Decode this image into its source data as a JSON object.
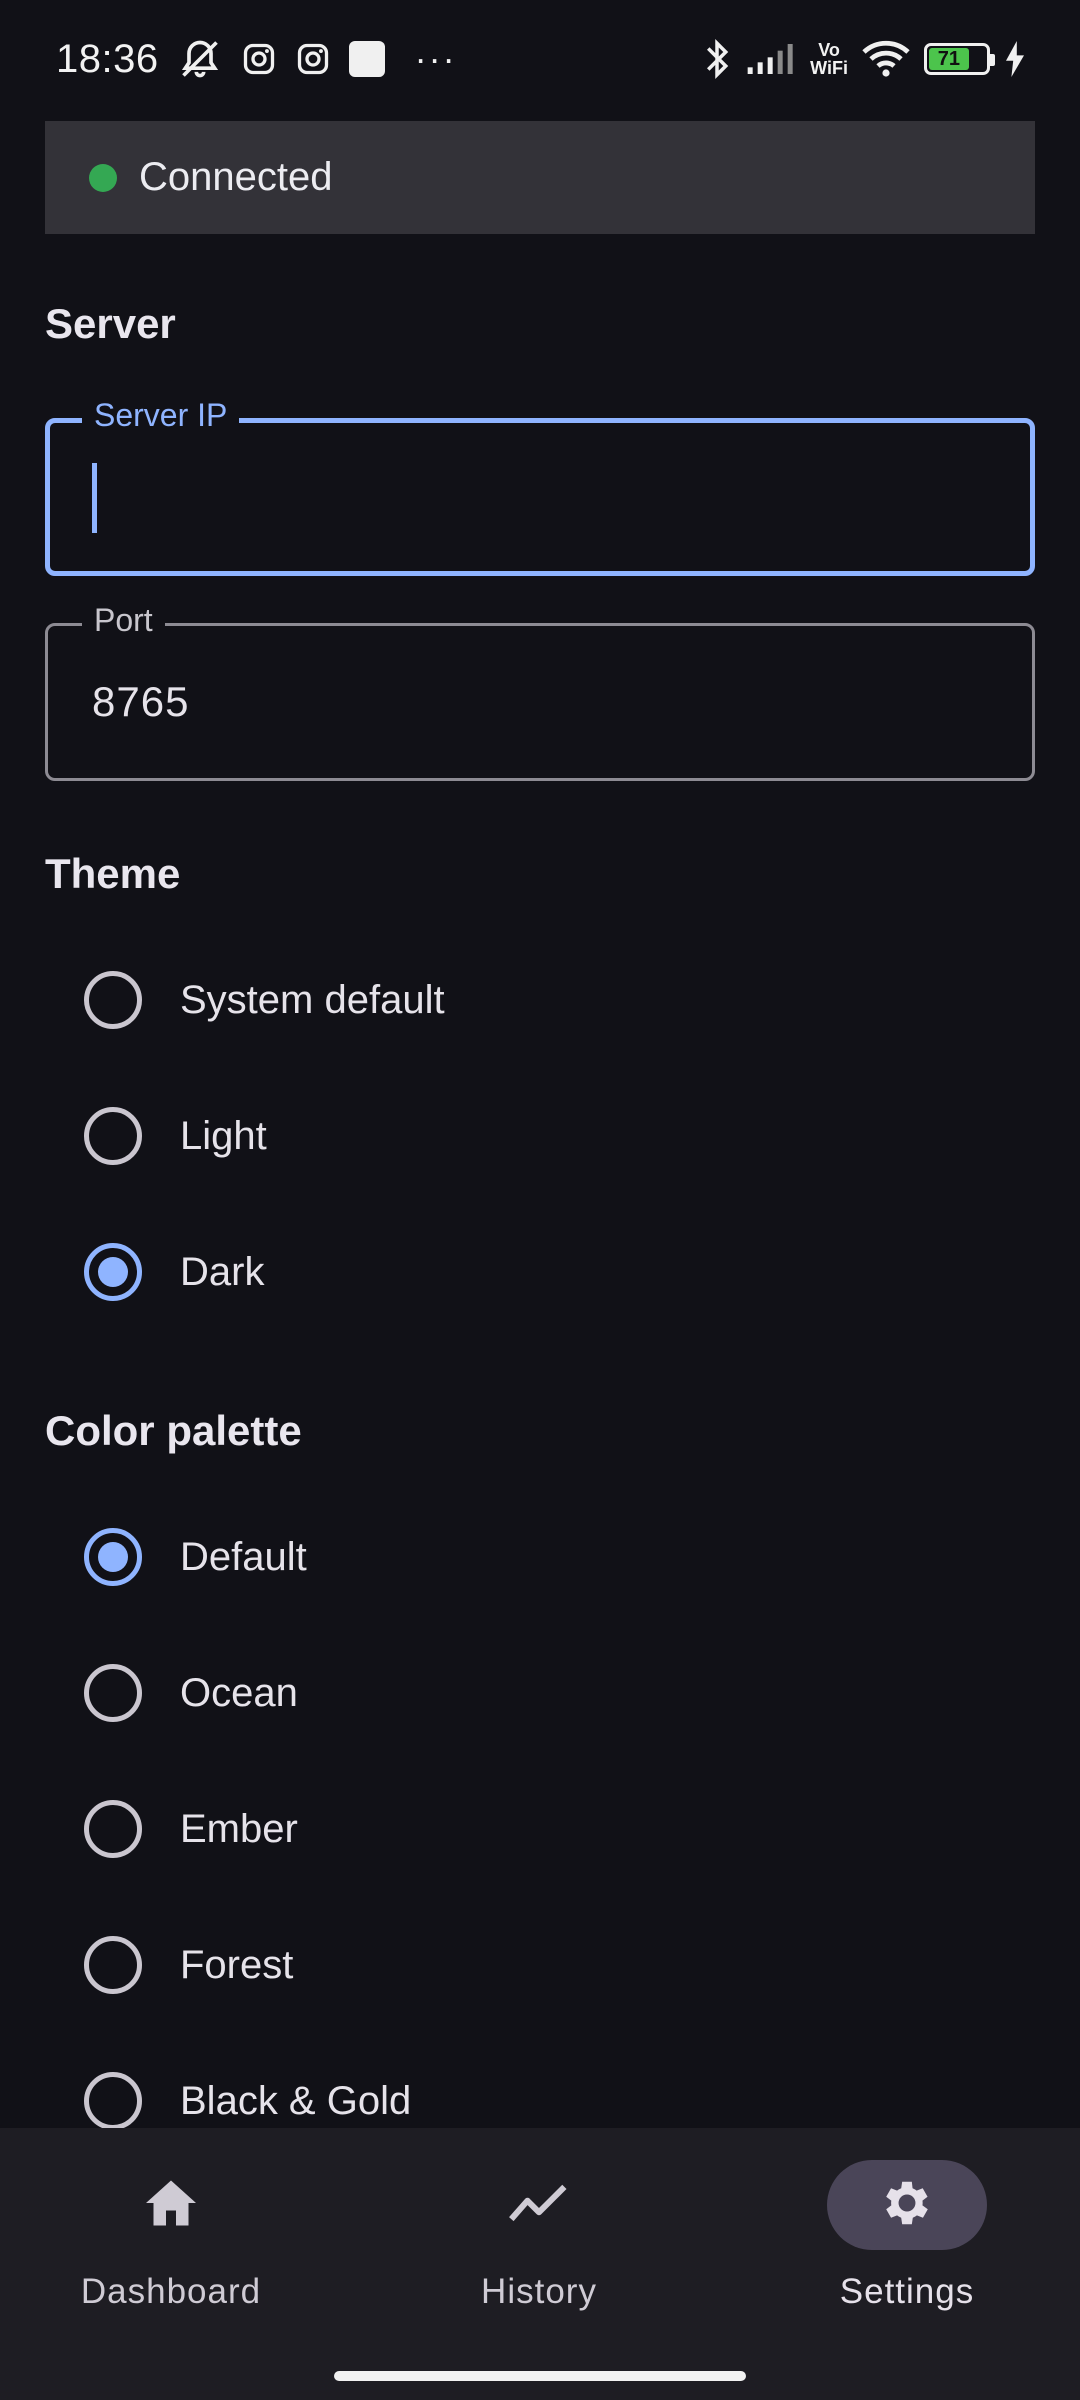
{
  "status_bar": {
    "time": "18:36",
    "battery_level": "71",
    "network_label_top": "Vo",
    "network_label_bottom": "WiFi",
    "overflow": "···"
  },
  "connection": {
    "status": "Connected",
    "color": "#34a853"
  },
  "server": {
    "section_title": "Server",
    "ip_field": {
      "label": "Server IP",
      "value": ""
    },
    "port_field": {
      "label": "Port",
      "value": "8765"
    }
  },
  "theme": {
    "section_title": "Theme",
    "options": [
      {
        "label": "System default",
        "selected": false
      },
      {
        "label": "Light",
        "selected": false
      },
      {
        "label": "Dark",
        "selected": true
      }
    ]
  },
  "palette": {
    "section_title": "Color palette",
    "options": [
      {
        "label": "Default",
        "selected": true
      },
      {
        "label": "Ocean",
        "selected": false
      },
      {
        "label": "Ember",
        "selected": false
      },
      {
        "label": "Forest",
        "selected": false
      },
      {
        "label": "Black & Gold",
        "selected": false
      }
    ]
  },
  "bottom_nav": {
    "items": [
      {
        "label": "Dashboard",
        "icon": "home-icon",
        "active": false
      },
      {
        "label": "History",
        "icon": "trending-line-icon",
        "active": false
      },
      {
        "label": "Settings",
        "icon": "gear-icon",
        "active": true
      }
    ]
  },
  "colors": {
    "accent": "#8fb4ff",
    "background": "#111117",
    "nav_background": "#1e1d23"
  }
}
